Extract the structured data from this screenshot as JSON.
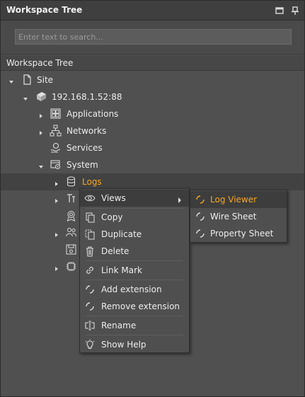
{
  "panel": {
    "title": "Workspace Tree",
    "search_placeholder": "Enter text to search...",
    "tree_header": "Workspace Tree"
  },
  "tree": {
    "site": "Site",
    "host": "192.168.1.52:88",
    "applications": "Applications",
    "networks": "Networks",
    "services": "Services",
    "system": "System",
    "logs": "Logs"
  },
  "context_menu": {
    "views": "Views",
    "copy": "Copy",
    "duplicate": "Duplicate",
    "delete": "Delete",
    "link_mark": "Link Mark",
    "add_extension": "Add extension",
    "remove_extension": "Remove extension",
    "rename": "Rename",
    "show_help": "Show Help"
  },
  "submenu": {
    "log_viewer": "Log Viewer",
    "wire_sheet": "Wire Sheet",
    "property_sheet": "Property Sheet"
  },
  "colors": {
    "accent": "#f5a623",
    "background": "#505050",
    "titlebar": "#3f3f3f"
  }
}
